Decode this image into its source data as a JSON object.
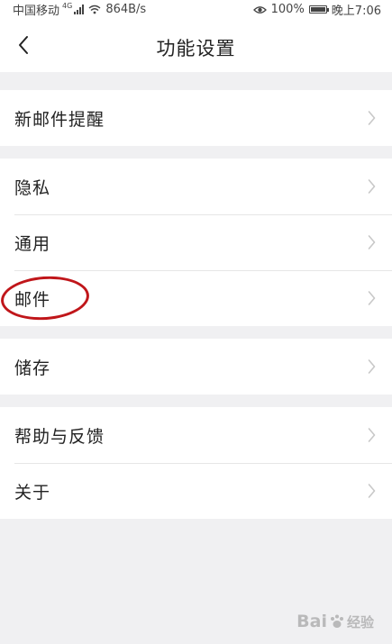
{
  "status_bar": {
    "carrier": "中国移动",
    "network_type": "4G",
    "speed": "864B/s",
    "battery": "100%",
    "time": "晚上7:06",
    "icons": [
      "signal-icon",
      "wifi-icon",
      "eye-icon",
      "battery-icon"
    ]
  },
  "nav": {
    "back_icon": "chevron-left-icon",
    "title": "功能设置"
  },
  "groups": [
    {
      "items": [
        {
          "label": "新邮件提醒"
        }
      ]
    },
    {
      "items": [
        {
          "label": "隐私"
        },
        {
          "label": "通用"
        },
        {
          "label": "邮件"
        }
      ]
    },
    {
      "items": [
        {
          "label": "储存"
        }
      ]
    },
    {
      "items": [
        {
          "label": "帮助与反馈"
        },
        {
          "label": "关于"
        }
      ]
    }
  ],
  "annotation": {
    "highlighted_item": "邮件",
    "color": "#c0161a"
  },
  "watermark": {
    "text": "Bai",
    "suffix": "经验"
  },
  "colors": {
    "background": "#f0f0f2",
    "card": "#ffffff",
    "text": "#222222",
    "chevron": "#c8c8c8",
    "divider": "#e6e6e6"
  }
}
